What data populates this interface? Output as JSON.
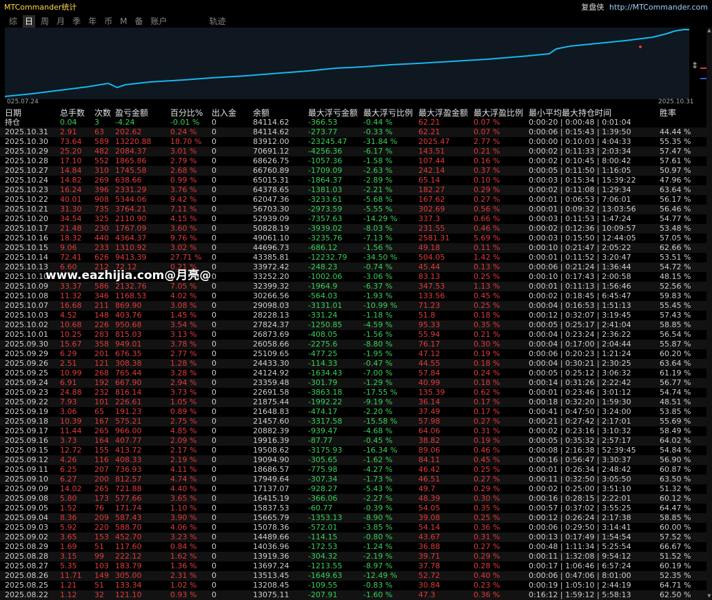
{
  "app_title": "MTCommander统计",
  "brand": {
    "text": "复盘侠",
    "url": "http://MTCommander.com"
  },
  "tabs": [
    {
      "label": "综"
    },
    {
      "label": "日"
    },
    {
      "label": "周"
    },
    {
      "label": "月"
    },
    {
      "label": "季"
    },
    {
      "label": "年"
    },
    {
      "label": "币"
    },
    {
      "label": "M"
    },
    {
      "label": "备"
    },
    {
      "label": "账户"
    },
    {
      "label": "轨迹"
    }
  ],
  "active_tab_index": 1,
  "chart": {
    "start_label": "025.07.24",
    "end_label": "2025.10.31"
  },
  "headers": [
    "日期",
    "总手数",
    "次数",
    "盈亏金额",
    "百分比%",
    "出入金",
    "余额",
    "最大浮亏金额",
    "最大浮亏比例",
    "最大浮盈金额",
    "最大浮盈比例",
    "最小平均最大持仓时间",
    "胜率"
  ],
  "holding_row": [
    "持仓",
    "0.04",
    "3",
    "-4.24",
    "-0.01 %",
    "0",
    "84114.62",
    "-366.53",
    "-0.44 %",
    "62.21",
    "0.07 %",
    "0:00:20 | 0:00:48 | 0:01:04",
    ""
  ],
  "rows": [
    [
      "2025.10.31",
      "2.91",
      "63",
      "202.62",
      "0.24 %",
      "0",
      "84114.62",
      "-273.77",
      "-0.33 %",
      "62.21",
      "0.07 %",
      "0:00:06 | 0:15:43 | 1:39:50",
      "44.44 %"
    ],
    [
      "2025.10.30",
      "73.64",
      "589",
      "13220.88",
      "18.70 %",
      "0",
      "83912.00",
      "-23245.47",
      "-31.84 %",
      "2025.47",
      "2.77 %",
      "0:00:00 | 0:10:03 | 4:04:33",
      "55.35 %"
    ],
    [
      "2025.10.29",
      "25.20",
      "482",
      "2084.37",
      "3.01 %",
      "0",
      "70691.12",
      "-4256.36",
      "-6.17 %",
      "143.51",
      "0.21 %",
      "0:00:02 | 0:11:33 | 2:03:34",
      "57.47 %"
    ],
    [
      "2025.10.28",
      "17.10",
      "552",
      "1865.86",
      "2.79 %",
      "0",
      "68626.75",
      "-1057.36",
      "-1.58 %",
      "107.44",
      "0.16 %",
      "0:00:02 | 0:10:45 | 8:00:42",
      "57.61 %"
    ],
    [
      "2025.10.27",
      "14.84",
      "310",
      "1745.58",
      "2.68 %",
      "0",
      "66760.89",
      "-1709.09",
      "-2.63 %",
      "242.14",
      "0.37 %",
      "0:00:05 | 0:11:50 | 1:16:05",
      "50.97 %"
    ],
    [
      "2025.10.24",
      "14.82",
      "269",
      "638.66",
      "0.99 %",
      "0",
      "65015.31",
      "-1864.37",
      "-2.89 %",
      "65.14",
      "0.10 %",
      "0:00:03 | 0:15:34 | 15:39:22",
      "47.96 %"
    ],
    [
      "2025.10.23",
      "16.24",
      "396",
      "2331.29",
      "3.76 %",
      "0",
      "64378.65",
      "-1381.03",
      "-2.21 %",
      "182.27",
      "0.29 %",
      "0:00:02 | 0:11:08 | 1:29:34",
      "63.64 %"
    ],
    [
      "2025.10.22",
      "40.01",
      "908",
      "5344.06",
      "9.42 %",
      "0",
      "62047.36",
      "-3233.61",
      "-5.68 %",
      "167.62",
      "0.27 %",
      "0:00:01 | 0:06:53 | 7:06:01",
      "56.17 %"
    ],
    [
      "2025.10.21",
      "31.30",
      "735",
      "3764.21",
      "7.11 %",
      "0",
      "56703.30",
      "-2973.59",
      "-5.55 %",
      "302.69",
      "0.56 %",
      "0:00:01 | 0:09:32 | 13:03:56",
      "56.46 %"
    ],
    [
      "2025.10.20",
      "34.54",
      "325",
      "2110.90",
      "4.15 %",
      "0",
      "52939.09",
      "-7357.63",
      "-14.29 %",
      "337.3",
      "0.66 %",
      "0:00:03 | 0:11:53 | 1:47:24",
      "54.77 %"
    ],
    [
      "2025.10.17",
      "21.48",
      "230",
      "1767.09",
      "3.60 %",
      "0",
      "50828.19",
      "-3939.02",
      "-8.03 %",
      "231.55",
      "0.46 %",
      "0:00:02 | 0:12:36 | 10:09:57",
      "53.48 %"
    ],
    [
      "2025.10.16",
      "18.32",
      "440",
      "4364.37",
      "9.76 %",
      "0",
      "49061.10",
      "-3235.76",
      "-7.13 %",
      "2581.31",
      "5.69 %",
      "0:00:03 | 0:15:50 | 12:44:05",
      "57.05 %"
    ],
    [
      "2025.10.15",
      "9.06",
      "233",
      "1310.92",
      "3.02 %",
      "0",
      "44696.73",
      "-686.12",
      "-1.56 %",
      "49.18",
      "0.11 %",
      "0:00:10 | 0:21:47 | 2:05:22",
      "62.66 %"
    ],
    [
      "2025.10.14",
      "72.41",
      "626",
      "9413.39",
      "27.71 %",
      "0",
      "43385.81",
      "-12232.79",
      "-34.50 %",
      "504.05",
      "1.42 %",
      "0:00:01 | 0:11:52 | 3:20:47",
      "53.51 %"
    ],
    [
      "2025.10.13",
      "6.60",
      "212",
      "72.12",
      "0.21 %",
      "0",
      "33972.42",
      "-248.23",
      "-0.74 %",
      "45.44",
      "0.13 %",
      "0:00:06 | 0:21:24 | 1:36:44",
      "54.72 %"
    ],
    [
      "2025.10.10",
      "",
      "",
      "",
      "",
      "0",
      "33252.20",
      "-1002.06",
      "-3.06 %",
      "83.13",
      "0.25 %",
      "0:00:10 | 0:17:43 | 2:00:58",
      "48.15 %"
    ],
    [
      "2025.10.09",
      "33.37",
      "586",
      "2132.76",
      "7.05 %",
      "0",
      "32399.32",
      "-1964.9",
      "-6.37 %",
      "347.53",
      "1.13 %",
      "0:00:01 | 0:11:13 | 1:56:46",
      "52.56 %"
    ],
    [
      "2025.10.08",
      "11.32",
      "346",
      "1168.53",
      "4.02 %",
      "0",
      "30266.56",
      "-564.03",
      "-1.93 %",
      "133.56",
      "0.45 %",
      "0:00:02 | 0:18:45 | 6:45:47",
      "59.83 %"
    ],
    [
      "2025.10.07",
      "16.68",
      "211",
      "869.90",
      "3.08 %",
      "0",
      "29098.03",
      "-3131.01",
      "-10.99 %",
      "71.23",
      "0.25 %",
      "0:00:04 | 0:16:53 | 1:51:13",
      "55.45 %"
    ],
    [
      "2025.10.03",
      "4.52",
      "148",
      "403.76",
      "1.45 %",
      "0",
      "28228.13",
      "-331.24",
      "-1.18 %",
      "51.8",
      "0.18 %",
      "0:00:12 | 0:32:07 | 3:19:45",
      "57.43 %"
    ],
    [
      "2025.10.02",
      "10.68",
      "226",
      "950.68",
      "3.54 %",
      "0",
      "27824.37",
      "-1250.85",
      "-4.59 %",
      "95.33",
      "0.35 %",
      "0:00:05 | 0:25:17 | 2:41:04",
      "58.85 %"
    ],
    [
      "2025.10.01",
      "10.25",
      "283",
      "815.03",
      "3.13 %",
      "0",
      "26873.69",
      "-408.05",
      "-1.56 %",
      "55.94",
      "0.21 %",
      "0:00:04 | 0:23:24 | 2:36:22",
      "56.54 %"
    ],
    [
      "2025.09.30",
      "15.67",
      "358",
      "949.01",
      "3.78 %",
      "0",
      "26058.66",
      "-2275.6",
      "-8.80 %",
      "76.17",
      "0.30 %",
      "0:00:04 | 0:17:00 | 2:04:44",
      "55.87 %"
    ],
    [
      "2025.09.29",
      "6.29",
      "201",
      "676.35",
      "2.77 %",
      "0",
      "25109.65",
      "-477.25",
      "-1.95 %",
      "47.12",
      "0.19 %",
      "0:00:06 | 0:20:23 | 1:21:24",
      "60.20 %"
    ],
    [
      "2025.09.26",
      "2.51",
      "121",
      "308.38",
      "1.28 %",
      "0",
      "24433.30",
      "-114.33",
      "-0.47 %",
      "44.55",
      "0.18 %",
      "0:00:04 | 0:30:21 | 2:30:25",
      "63.64 %"
    ],
    [
      "2025.09.25",
      "10.99",
      "268",
      "765.44",
      "3.28 %",
      "0",
      "24124.92",
      "-1634.43",
      "-7.00 %",
      "57.84",
      "0.24 %",
      "0:00:05 | 0:25:12 | 3:06:32",
      "61.19 %"
    ],
    [
      "2025.09.24",
      "6.91",
      "192",
      "667.90",
      "2.94 %",
      "0",
      "23359.48",
      "-301.79",
      "-1.29 %",
      "40.99",
      "0.18 %",
      "0:00:14 | 0:31:26 | 2:22:42",
      "56.77 %"
    ],
    [
      "2025.09.23",
      "24.88",
      "232",
      "816.14",
      "3.73 %",
      "0",
      "22691.58",
      "-3863.18",
      "-17.55 %",
      "135.39",
      "0.62 %",
      "0:00:01 | 0:23:46 | 3:01:12",
      "54.74 %"
    ],
    [
      "2025.09.22",
      "7.93",
      "101",
      "226.61",
      "1.05 %",
      "0",
      "21875.44",
      "-1992.22",
      "-9.19 %",
      "36.14",
      "0.17 %",
      "0:00:18 | 0:32:20 | 1:59:30",
      "48.51 %"
    ],
    [
      "2025.09.19",
      "3.06",
      "65",
      "191.23",
      "0.89 %",
      "0",
      "21648.83",
      "-474.17",
      "-2.20 %",
      "37.49",
      "0.17 %",
      "0:00:41 | 0:47:50 | 3:24:00",
      "53.85 %"
    ],
    [
      "2025.09.18",
      "10.39",
      "167",
      "575.21",
      "2.75 %",
      "0",
      "21457.60",
      "-3317.58",
      "-15.58 %",
      "57.98",
      "0.27 %",
      "0:00:21 | 0:27:42 | 2:17:01",
      "55.69 %"
    ],
    [
      "2025.09.17",
      "11.44",
      "265",
      "966.00",
      "4.85 %",
      "0",
      "20882.39",
      "-939.47",
      "-4.68 %",
      "64.06",
      "0.31 %",
      "0:00:02 | 0:23:16 | 3:10:32",
      "58.49 %"
    ],
    [
      "2025.09.16",
      "3.73",
      "164",
      "407.77",
      "2.09 %",
      "0",
      "19916.39",
      "-87.77",
      "-0.45 %",
      "38.82",
      "0.19 %",
      "0:00:05 | 0:35:32 | 2:57:17",
      "64.02 %"
    ],
    [
      "2025.09.15",
      "12.72",
      "155",
      "413.72",
      "2.17 %",
      "0",
      "19508.62",
      "-3175.93",
      "-16.34 %",
      "89.06",
      "0.46 %",
      "0:00:08 | 2:16:38 | 52:39:45",
      "54.84 %"
    ],
    [
      "2025.09.12",
      "4.26",
      "116",
      "408.33",
      "2.19 %",
      "0",
      "19094.90",
      "-305.65",
      "-1.62 %",
      "84.11",
      "0.45 %",
      "0:00:16 | 0:56:47 | 3:30:37",
      "56.90 %"
    ],
    [
      "2025.09.11",
      "6.25",
      "207",
      "736.93",
      "4.11 %",
      "0",
      "18686.57",
      "-775.98",
      "-4.27 %",
      "46.42",
      "0.25 %",
      "0:00:01 | 0:26:34 | 2:48:42",
      "60.87 %"
    ],
    [
      "2025.09.10",
      "6.27",
      "200",
      "812.57",
      "4.74 %",
      "0",
      "17949.64",
      "-307.34",
      "-1.73 %",
      "46.51",
      "0.27 %",
      "0:00:11 | 0:32:50 | 3:05:50",
      "63.50 %"
    ],
    [
      "2025.09.09",
      "14.02",
      "265",
      "721.88",
      "4.40 %",
      "0",
      "17137.07",
      "-928.27",
      "-5.43 %",
      "49.7",
      "0.29 %",
      "0:00:02 | 0:25:00 | 3:51:10",
      "51.32 %"
    ],
    [
      "2025.09.08",
      "5.80",
      "173",
      "577.66",
      "3.65 %",
      "0",
      "16415.19",
      "-366.06",
      "-2.27 %",
      "48.39",
      "0.30 %",
      "0:00:16 | 0:28:15 | 2:22:01",
      "60.12 %"
    ],
    [
      "2025.09.05",
      "1.52",
      "76",
      "171.74",
      "1.10 %",
      "0",
      "15837.53",
      "-60.77",
      "-0.39 %",
      "54.05",
      "0.35 %",
      "0:00:57 | 0:37:02 | 3:55:25",
      "64.47 %"
    ],
    [
      "2025.09.04",
      "8.36",
      "209",
      "587.43",
      "3.90 %",
      "0",
      "15665.79",
      "-1353.13",
      "-8.90 %",
      "39.08",
      "0.25 %",
      "0:00:12 | 0:26:24 | 2:17:38",
      "58.85 %"
    ],
    [
      "2025.09.03",
      "5.92",
      "220",
      "588.70",
      "4.06 %",
      "0",
      "15078.36",
      "-572.01",
      "-3.85 %",
      "54.14",
      "0.36 %",
      "0:00:06 | 0:29:50 | 3:14:41",
      "60.00 %"
    ],
    [
      "2025.09.02",
      "3.65",
      "153",
      "452.70",
      "3.23 %",
      "0",
      "14489.66",
      "-114.15",
      "-0.80 %",
      "43.67",
      "0.31 %",
      "0:00:13 | 0:17:49 | 1:54:54",
      "57.52 %"
    ],
    [
      "2025.08.29",
      "1.69",
      "51",
      "117.60",
      "0.84 %",
      "0",
      "14036.96",
      "-172.53",
      "-1.24 %",
      "36.88",
      "0.27 %",
      "0:00:48 | 1:11:34 | 5:25:54",
      "66.67 %"
    ],
    [
      "2025.08.28",
      "3.15",
      "99",
      "222.12",
      "1.62 %",
      "0",
      "13919.36",
      "-304.32",
      "-2.19 %",
      "39.71",
      "0.29 %",
      "0:00:11 | 1:32:08 | 9:54:12",
      "51.52 %"
    ],
    [
      "2025.08.27",
      "5.35",
      "103",
      "183.79",
      "1.36 %",
      "0",
      "13697.24",
      "-1213.55",
      "-8.97 %",
      "37.78",
      "0.28 %",
      "0:00:17 | 1:06:46 | 6:57:24",
      "60.19 %"
    ],
    [
      "2025.08.26",
      "11.71",
      "149",
      "305.00",
      "2.31 %",
      "0",
      "13513.45",
      "-1649.63",
      "-12.49 %",
      "52.72",
      "0.40 %",
      "0:00:06 | 0:47:06 | 8:01:00",
      "52.35 %"
    ],
    [
      "2025.08.25",
      "1.21",
      "51",
      "133.34",
      "1.02 %",
      "0",
      "13208.45",
      "-109.55",
      "-0.83 %",
      "30.84",
      "0.23 %",
      "0:00:19 | 1:05:10 | 2:44:19",
      "64.71 %"
    ],
    [
      "2025.08.22",
      "1.12",
      "32",
      "121.10",
      "0.93 %",
      "0",
      "13075.11",
      "-207.91",
      "-1.60 %",
      "47.3",
      "0.36 %",
      "0:16:12 | 1:59:12 | 5:58:13",
      "62.50 %"
    ]
  ],
  "watermark": "www.eazhijia.com@月亮@",
  "colors": {
    "background": "#000000",
    "chart_bg": "#0f1720",
    "equity_line": "#16b8f0",
    "profit_red": "#e23a3a",
    "drawdown_green": "#36d156",
    "holding_green": "#36d156",
    "title_yellow": "#ffd84a",
    "text": "#dddddd"
  },
  "icons": {
    "side_toggle": "double-chevron-icon"
  }
}
